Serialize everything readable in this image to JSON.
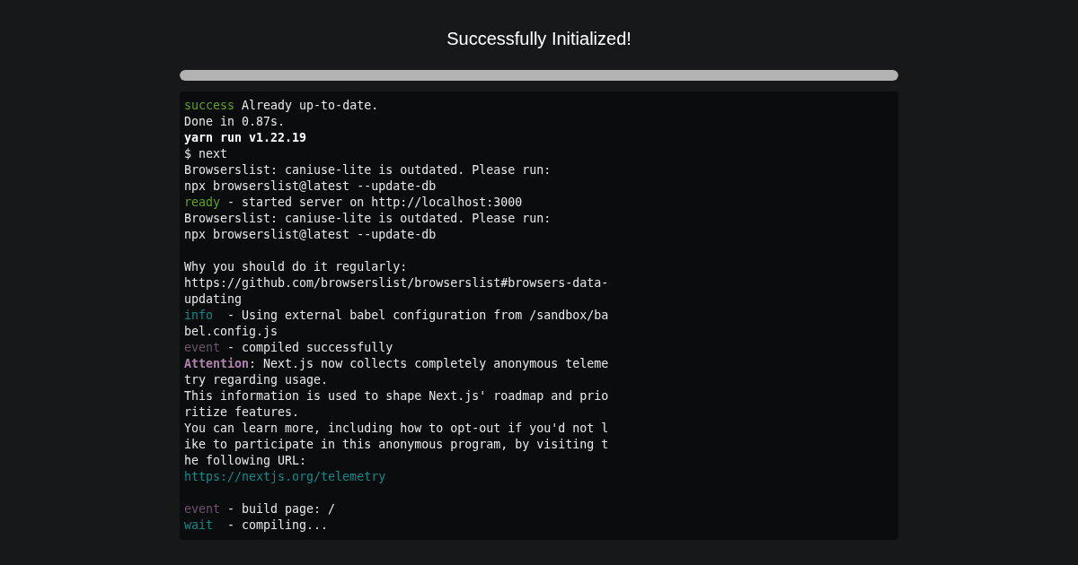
{
  "title": "Successfully Initialized!",
  "progress": {
    "level": 1
  },
  "terminal": {
    "lines": [
      {
        "kind": "text",
        "segments": [
          {
            "kind": "success",
            "text": "success"
          },
          {
            "kind": "plain",
            "text": " Already up-to-date."
          }
        ]
      },
      {
        "kind": "text",
        "segments": [
          {
            "kind": "plain",
            "text": "Done in 0.87s."
          }
        ]
      },
      {
        "kind": "text",
        "segments": [
          {
            "kind": "bold",
            "text": "yarn run v1.22.19"
          }
        ]
      },
      {
        "kind": "text",
        "segments": [
          {
            "kind": "plain",
            "text": "$ next"
          }
        ]
      },
      {
        "kind": "text",
        "segments": [
          {
            "kind": "plain",
            "text": "Browserslist: caniuse-lite is outdated. Please run:"
          }
        ]
      },
      {
        "kind": "text",
        "segments": [
          {
            "kind": "plain",
            "text": "npx browserslist@latest --update-db"
          }
        ]
      },
      {
        "kind": "text",
        "segments": [
          {
            "kind": "success",
            "text": "ready"
          },
          {
            "kind": "plain",
            "text": " - started server on http://localhost:3000"
          }
        ]
      },
      {
        "kind": "text",
        "segments": [
          {
            "kind": "plain",
            "text": "Browserslist: caniuse-lite is outdated. Please run:"
          }
        ]
      },
      {
        "kind": "text",
        "segments": [
          {
            "kind": "plain",
            "text": "npx browserslist@latest --update-db"
          }
        ]
      },
      {
        "kind": "blank"
      },
      {
        "kind": "text",
        "segments": [
          {
            "kind": "plain",
            "text": "Why you should do it regularly:"
          }
        ]
      },
      {
        "kind": "text",
        "segments": [
          {
            "kind": "plain",
            "text": "https://github.com/browserslist/browserslist#browsers-data-"
          }
        ]
      },
      {
        "kind": "text",
        "segments": [
          {
            "kind": "plain",
            "text": "updating"
          }
        ]
      },
      {
        "kind": "text",
        "segments": [
          {
            "kind": "info",
            "text": "info"
          },
          {
            "kind": "plain",
            "text": "  - Using external babel configuration from /sandbox/ba"
          }
        ]
      },
      {
        "kind": "text",
        "segments": [
          {
            "kind": "plain",
            "text": "bel.config.js"
          }
        ]
      },
      {
        "kind": "text",
        "segments": [
          {
            "kind": "event",
            "text": "event"
          },
          {
            "kind": "plain",
            "text": " - compiled successfully"
          }
        ]
      },
      {
        "kind": "text",
        "segments": [
          {
            "kind": "attention",
            "text": "Attention"
          },
          {
            "kind": "plain",
            "text": ": Next.js now collects completely anonymous teleme"
          }
        ]
      },
      {
        "kind": "text",
        "segments": [
          {
            "kind": "plain",
            "text": "try regarding usage."
          }
        ]
      },
      {
        "kind": "text",
        "segments": [
          {
            "kind": "plain",
            "text": "This information is used to shape Next.js' roadmap and prio"
          }
        ]
      },
      {
        "kind": "text",
        "segments": [
          {
            "kind": "plain",
            "text": "ritize features."
          }
        ]
      },
      {
        "kind": "text",
        "segments": [
          {
            "kind": "plain",
            "text": "You can learn more, including how to opt-out if you'd not l"
          }
        ]
      },
      {
        "kind": "text",
        "segments": [
          {
            "kind": "plain",
            "text": "ike to participate in this anonymous program, by visiting t"
          }
        ]
      },
      {
        "kind": "text",
        "segments": [
          {
            "kind": "plain",
            "text": "he following URL:"
          }
        ]
      },
      {
        "kind": "link",
        "segments": [
          {
            "kind": "info",
            "text": "https://nextjs.org/telemetry"
          }
        ]
      },
      {
        "kind": "blank"
      },
      {
        "kind": "text",
        "segments": [
          {
            "kind": "event",
            "text": "event"
          },
          {
            "kind": "plain",
            "text": " - build page: /"
          }
        ]
      },
      {
        "kind": "text",
        "segments": [
          {
            "kind": "info",
            "text": "wait"
          },
          {
            "kind": "plain",
            "text": "  - compiling..."
          }
        ]
      }
    ]
  }
}
